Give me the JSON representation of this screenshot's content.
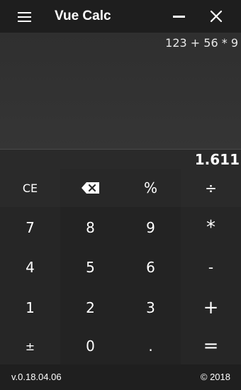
{
  "app": {
    "title": "Vue Calc"
  },
  "display": {
    "expression": "123 + 56 * 9",
    "result": "1.611"
  },
  "keys": [
    {
      "id": "clear-entry",
      "label": "CE"
    },
    {
      "id": "backspace",
      "icon": "backspace-icon"
    },
    {
      "id": "percent",
      "label": "%"
    },
    {
      "id": "divide",
      "label": "÷"
    },
    {
      "id": "digit-7",
      "label": "7"
    },
    {
      "id": "digit-8",
      "label": "8"
    },
    {
      "id": "digit-9",
      "label": "9"
    },
    {
      "id": "multiply",
      "label": "*"
    },
    {
      "id": "digit-4",
      "label": "4"
    },
    {
      "id": "digit-5",
      "label": "5"
    },
    {
      "id": "digit-6",
      "label": "6"
    },
    {
      "id": "subtract",
      "label": "-"
    },
    {
      "id": "digit-1",
      "label": "1"
    },
    {
      "id": "digit-2",
      "label": "2"
    },
    {
      "id": "digit-3",
      "label": "3"
    },
    {
      "id": "add",
      "label": "+"
    },
    {
      "id": "negate",
      "label": "±"
    },
    {
      "id": "digit-0",
      "label": "0"
    },
    {
      "id": "decimal",
      "label": "."
    },
    {
      "id": "equals",
      "label": "="
    }
  ],
  "footer": {
    "version": "v.0.18.04.06",
    "copyright": "© 2018"
  },
  "icons": {
    "menu": "menu-icon",
    "minimize": "minimize-icon",
    "close": "close-icon",
    "backspace": "backspace-icon"
  }
}
